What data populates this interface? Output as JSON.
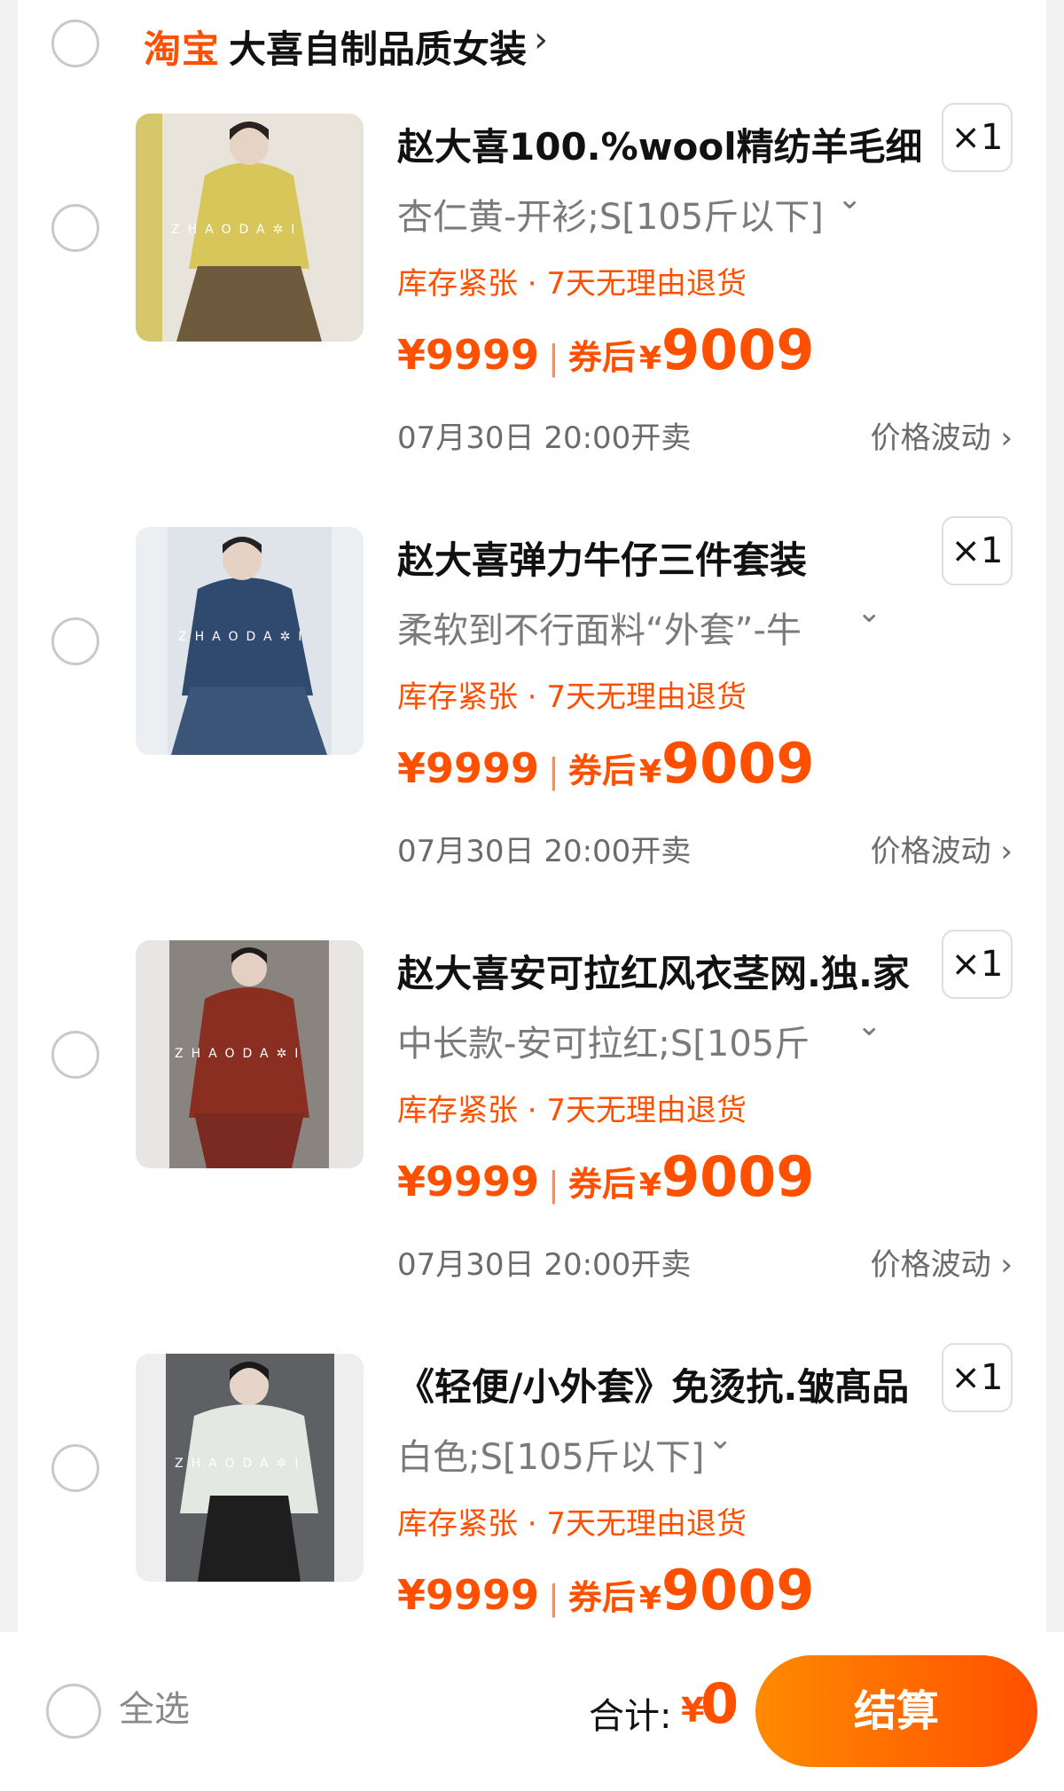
{
  "shop": {
    "logo": "淘宝",
    "name": "大喜自制品质女装",
    "chevron": "›"
  },
  "items": [
    {
      "title": "赵大喜100.%wool精纺羊毛细",
      "quantity": "×1",
      "sku": "杏仁黄-开衫;S[105斤以下]",
      "sku_chevron": "⌄",
      "tags": "库存紧张 · 7天无理由退货",
      "price_original": "¥9999",
      "price_sep": "|",
      "price_label": "券后",
      "price_yen": "¥",
      "price_final": "9009",
      "sale_time": "07月30日 20:00开卖",
      "price_fluct": "价格波动 ›",
      "image_brand": "ZHAODA✲I",
      "image_colors": {
        "bg": "#e8e4dc",
        "garment": "#d8c65a",
        "skirt": "#6e5a3c"
      }
    },
    {
      "title": "赵大喜弹力牛仔三件套装",
      "quantity": "×1",
      "sku": "柔软到不行面料“外套”-牛",
      "sku_chevron": "⌄",
      "tags": "库存紧张 · 7天无理由退货",
      "price_original": "¥9999",
      "price_sep": "|",
      "price_label": "券后",
      "price_yen": "¥",
      "price_final": "9009",
      "sale_time": "07月30日 20:00开卖",
      "price_fluct": "价格波动 ›",
      "image_brand": "ZHAODA✲I",
      "image_colors": {
        "bg": "#eceff2",
        "garment": "#2f4a6e",
        "skirt": "#3b5578"
      }
    },
    {
      "title": "赵大喜安可拉红风衣茎网.独.家",
      "quantity": "×1",
      "sku": "中长款-安可拉红;S[105斤",
      "sku_chevron": "⌄",
      "tags": "库存紧张 · 7天无理由退货",
      "price_original": "¥9999",
      "price_sep": "|",
      "price_label": "券后",
      "price_yen": "¥",
      "price_final": "9009",
      "sale_time": "07月30日 20:00开卖",
      "price_fluct": "价格波动 ›",
      "image_brand": "ZHAODA✲I",
      "image_colors": {
        "bg": "#8a8480",
        "garment": "#8a2e22",
        "skirt": "#7a2a20"
      }
    },
    {
      "title": "《轻便/小外套》免烫抗.皱髙品",
      "quantity": "×1",
      "sku": "白色;S[105斤以下]",
      "sku_chevron": "⌄",
      "tags": "库存紧张 · 7天无理由退货",
      "price_original": "¥9999",
      "price_sep": "|",
      "price_label": "券后",
      "price_yen": "¥",
      "price_final": "9009",
      "image_brand": "ZHAODA✲I",
      "image_colors": {
        "bg": "#5e6064",
        "garment": "#e3e8e2",
        "skirt": "#1e1e1e"
      }
    }
  ],
  "footer": {
    "select_all": "全选",
    "total_label": "合计:",
    "total_yen": "¥",
    "total_value": "0",
    "checkout_label": "结算"
  },
  "colors": {
    "accent": "#ff5000",
    "checkout_gradient_start": "#ff8a00",
    "checkout_gradient_end": "#ff5000"
  }
}
